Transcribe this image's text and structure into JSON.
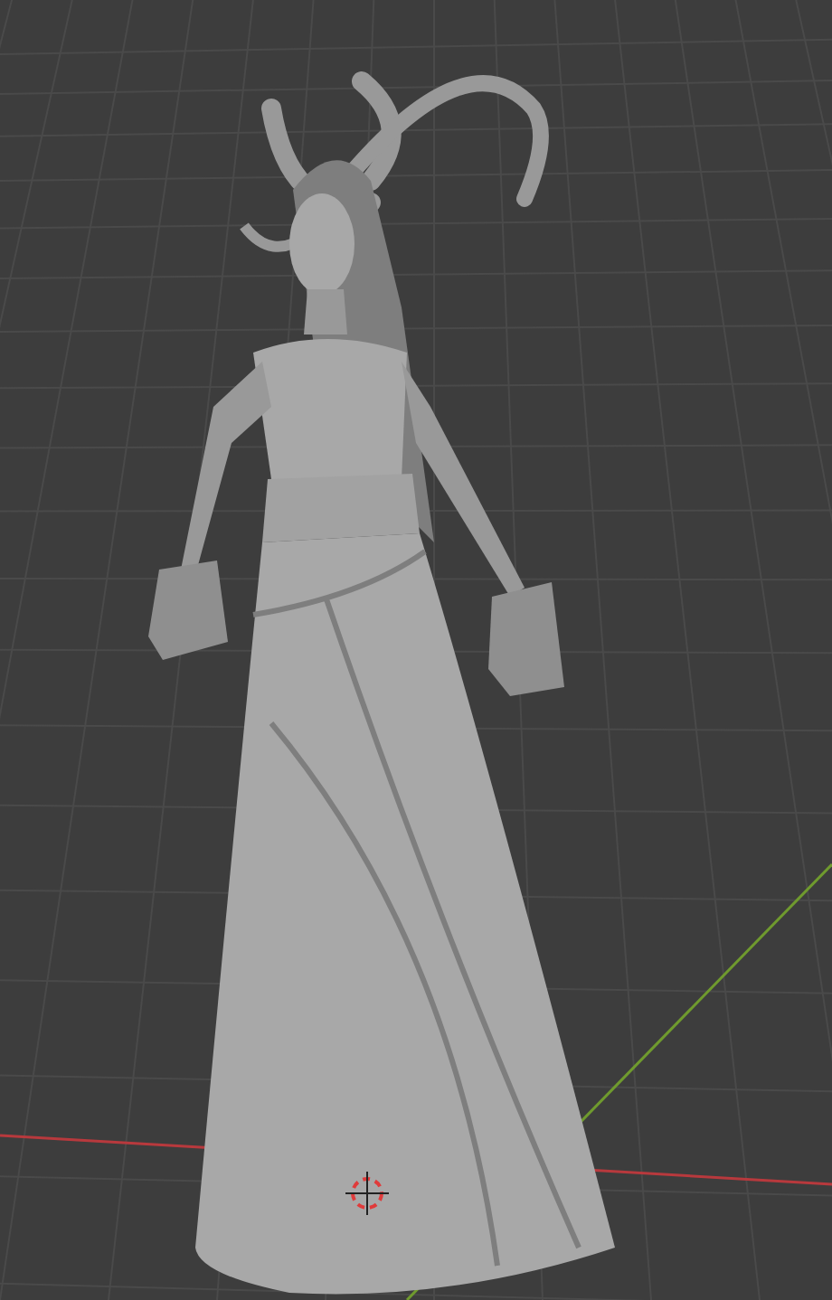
{
  "viewport": {
    "axes": [
      {
        "color": "#b8393d"
      },
      {
        "color": "#6f9a2e"
      }
    ]
  }
}
